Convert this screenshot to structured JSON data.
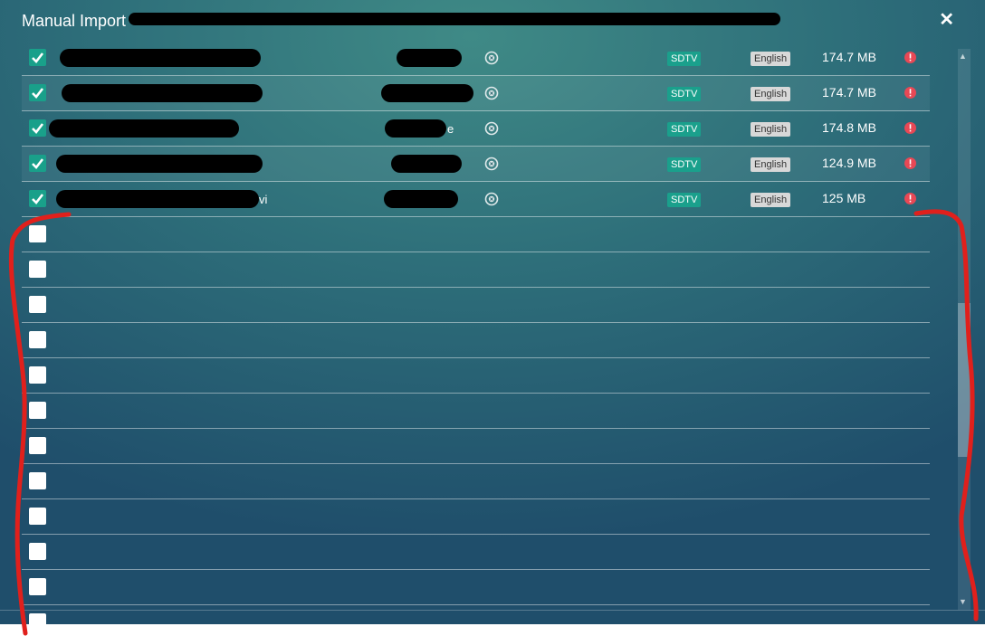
{
  "header": {
    "title": "Manual Import",
    "subtitle": ""
  },
  "rows": [
    {
      "checked": true,
      "suffix": "",
      "mid_suffix": "",
      "quality": "SDTV",
      "language": "English",
      "size": "174.7 MB"
    },
    {
      "checked": true,
      "suffix": "",
      "mid_suffix": "",
      "quality": "SDTV",
      "language": "English",
      "size": "174.7 MB"
    },
    {
      "checked": true,
      "suffix": "",
      "mid_suffix": "e",
      "quality": "SDTV",
      "language": "English",
      "size": "174.8 MB"
    },
    {
      "checked": true,
      "suffix": "",
      "mid_suffix": "",
      "quality": "SDTV",
      "language": "English",
      "size": "124.9 MB"
    },
    {
      "checked": true,
      "suffix": "vi",
      "mid_suffix": "",
      "quality": "SDTV",
      "language": "English",
      "size": "125 MB"
    }
  ],
  "empty_rows": 12,
  "colors": {
    "accent": "#19a08a",
    "warning": "#e84855",
    "annotation": "#e0201c"
  }
}
